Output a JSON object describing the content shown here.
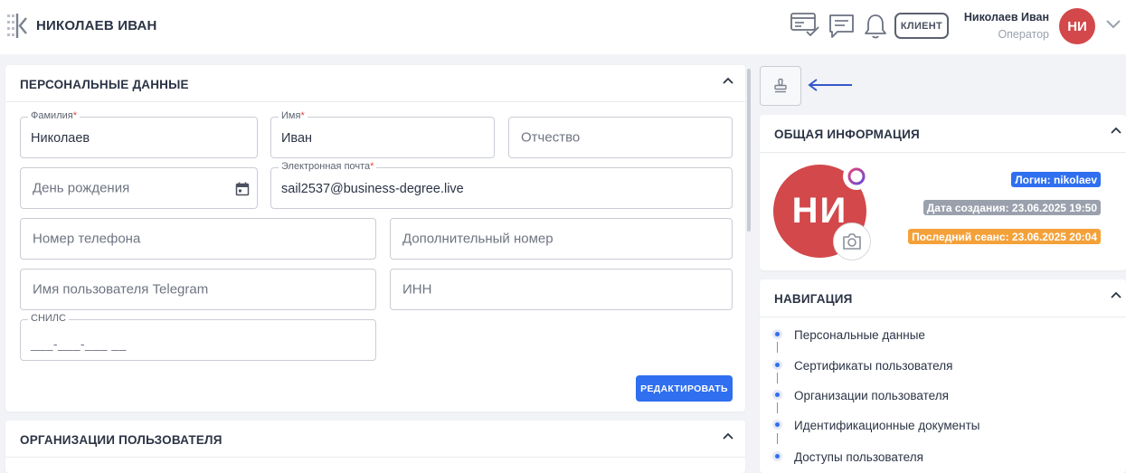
{
  "header": {
    "title": "НИКОЛАЕВ ИВАН",
    "client_button": "КЛИЕНТ",
    "user_name": "Николаев Иван",
    "user_role": "Оператор",
    "avatar_initials": "НИ",
    "icons": [
      "logo-icon",
      "tasks-icon",
      "chat-icon",
      "bell-icon",
      "chevron-down-icon"
    ]
  },
  "personal": {
    "title": "ПЕРСОНАЛЬНЫЕ ДАННЫЕ",
    "last_name_label": "Фамилия",
    "last_name_value": "Николаев",
    "first_name_label": "Имя",
    "first_name_value": "Иван",
    "patronymic_placeholder": "Отчество",
    "birthday_placeholder": "День рождения",
    "email_label": "Электронная почта",
    "email_value": "sail2537@business-degree.live",
    "phone_placeholder": "Номер телефона",
    "extra_phone_placeholder": "Дополнительный номер",
    "telegram_placeholder": "Имя пользователя Telegram",
    "inn_placeholder": "ИНН",
    "snils_label": "СНИЛС",
    "snils_mask": "___-___-___ __",
    "required_mark": "*",
    "edit_button": "РЕДАКТИРОВАТЬ"
  },
  "organizations": {
    "title": "ОРГАНИЗАЦИИ ПОЛЬЗОВАТЕЛЯ"
  },
  "general": {
    "title": "ОБЩАЯ ИНФОРМАЦИЯ",
    "avatar_initials": "НИ",
    "login": "Логин: nikolaev",
    "created": "Дата создания: 23.06.2025 19:50",
    "last_session": "Последний сеанс: 23.06.2025 20:04"
  },
  "navigation": {
    "title": "НАВИГАЦИЯ",
    "items": [
      "Персональные данные",
      "Сертификаты пользователя",
      "Организации пользователя",
      "Идентификационные документы",
      "Доступы пользователя"
    ]
  },
  "colors": {
    "accent": "#2f6ff0",
    "avatar": "#d3484a",
    "tag_gray": "#9aa1ad",
    "tag_orange": "#f4a13a"
  }
}
